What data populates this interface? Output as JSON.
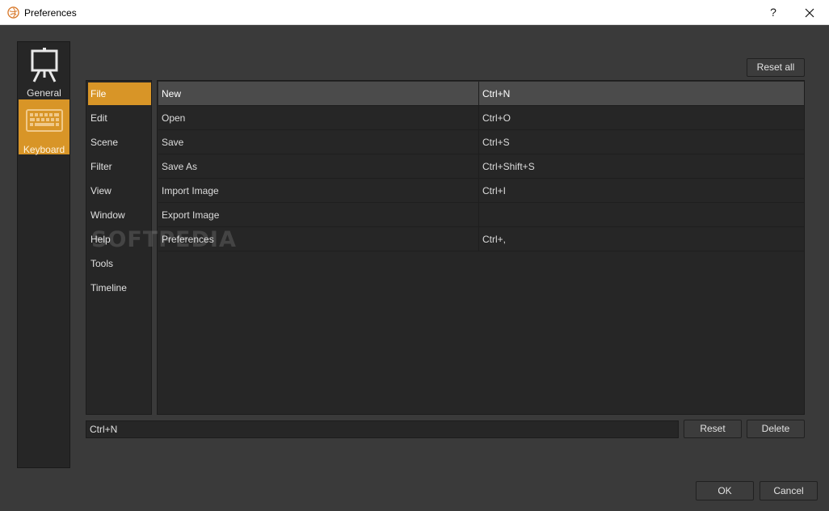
{
  "window": {
    "title": "Preferences",
    "help_label": "?"
  },
  "categories": [
    {
      "label": "General",
      "icon": "easel-icon"
    },
    {
      "label": "Keyboard",
      "icon": "keyboard-icon",
      "active": true
    }
  ],
  "toolbar": {
    "reset_all_label": "Reset all"
  },
  "menus": [
    {
      "label": "File",
      "active": true
    },
    {
      "label": "Edit"
    },
    {
      "label": "Scene"
    },
    {
      "label": "Filter"
    },
    {
      "label": "View"
    },
    {
      "label": "Window"
    },
    {
      "label": "Help"
    },
    {
      "label": "Tools"
    },
    {
      "label": "Timeline"
    }
  ],
  "shortcuts": [
    {
      "command": "New",
      "key": "Ctrl+N",
      "selected": true
    },
    {
      "command": "Open",
      "key": "Ctrl+O"
    },
    {
      "command": "Save",
      "key": "Ctrl+S"
    },
    {
      "command": "Save As",
      "key": "Ctrl+Shift+S"
    },
    {
      "command": "Import Image",
      "key": "Ctrl+I"
    },
    {
      "command": "Export Image",
      "key": ""
    },
    {
      "command": "Preferences",
      "key": "Ctrl+,"
    }
  ],
  "editor": {
    "key_value": "Ctrl+N",
    "reset_label": "Reset",
    "delete_label": "Delete"
  },
  "footer": {
    "ok_label": "OK",
    "cancel_label": "Cancel"
  },
  "watermark": "SOFTPEDIA",
  "colors": {
    "accent": "#d89527",
    "background": "#3a3a3a",
    "panel": "#262626",
    "selected_row": "#4b4b4b"
  }
}
